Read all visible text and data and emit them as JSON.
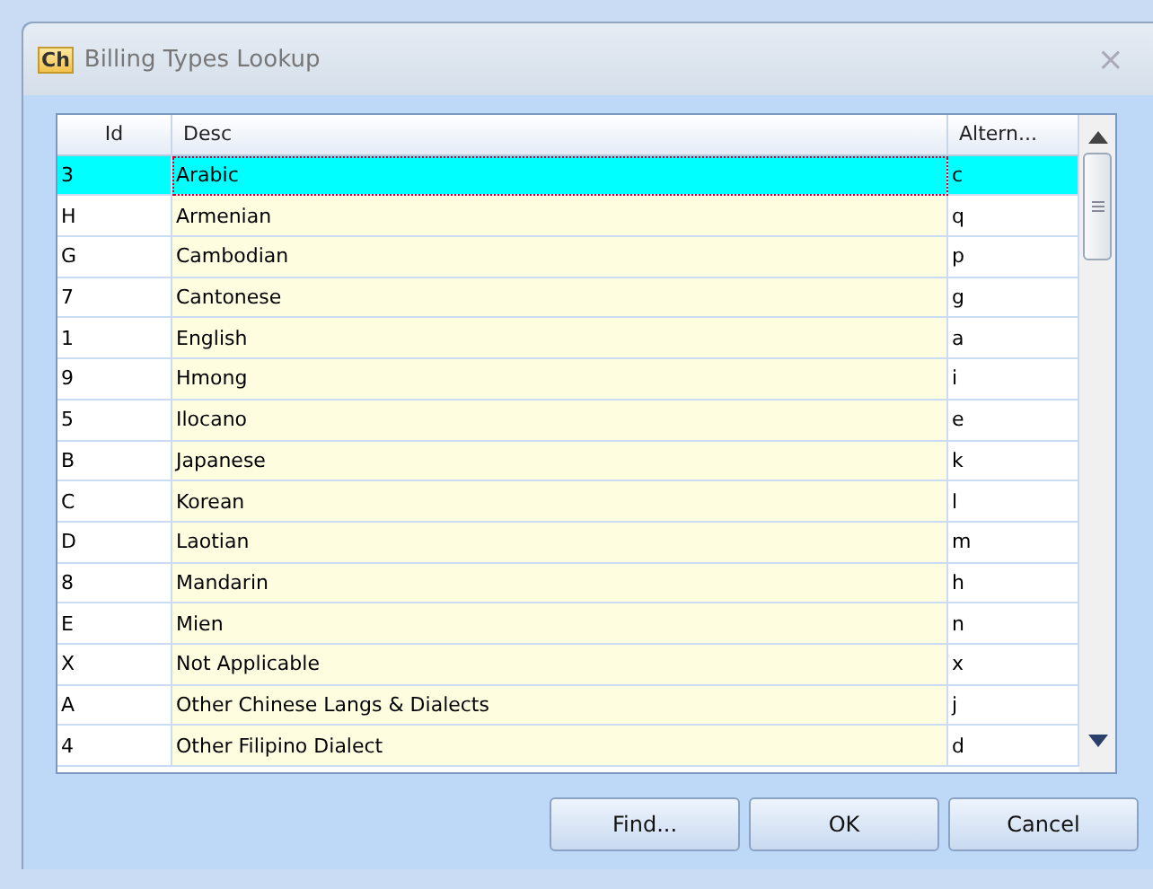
{
  "window": {
    "title": "Billing Types Lookup",
    "app_badge": "Ch",
    "close": "×"
  },
  "table": {
    "columns": [
      "Id",
      "Desc",
      "Altern..."
    ],
    "rows": [
      {
        "cells": [
          "3",
          "Arabic",
          "c"
        ],
        "selected": true
      },
      {
        "cells": [
          "H",
          "Armenian",
          "q"
        ],
        "selected": false
      },
      {
        "cells": [
          "G",
          "Cambodian",
          "p"
        ],
        "selected": false
      },
      {
        "cells": [
          "7",
          "Cantonese",
          "g"
        ],
        "selected": false
      },
      {
        "cells": [
          "1",
          "English",
          "a"
        ],
        "selected": false
      },
      {
        "cells": [
          "9",
          "Hmong",
          "i"
        ],
        "selected": false
      },
      {
        "cells": [
          "5",
          "Ilocano",
          "e"
        ],
        "selected": false
      },
      {
        "cells": [
          "B",
          "Japanese",
          "k"
        ],
        "selected": false
      },
      {
        "cells": [
          "C",
          "Korean",
          "l"
        ],
        "selected": false
      },
      {
        "cells": [
          "D",
          "Laotian",
          "m"
        ],
        "selected": false
      },
      {
        "cells": [
          "8",
          "Mandarin",
          "h"
        ],
        "selected": false
      },
      {
        "cells": [
          "E",
          "Mien",
          "n"
        ],
        "selected": false
      },
      {
        "cells": [
          "X",
          "Not Applicable",
          "x"
        ],
        "selected": false
      },
      {
        "cells": [
          "A",
          "Other Chinese Langs & Dialects",
          "j"
        ],
        "selected": false
      },
      {
        "cells": [
          "4",
          "Other Filipino Dialect",
          "d"
        ],
        "selected": false
      }
    ]
  },
  "buttons": [
    "Find...",
    "OK",
    "Cancel"
  ]
}
